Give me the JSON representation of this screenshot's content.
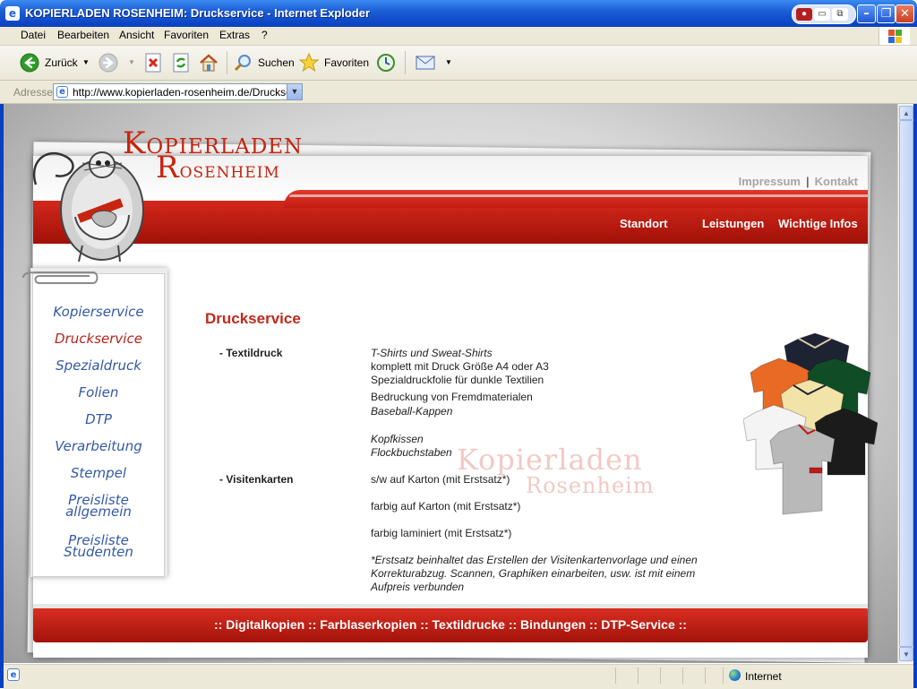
{
  "window": {
    "title": "KOPIERLADEN ROSENHEIM: Druckservice - Internet Exploder"
  },
  "menu": [
    "Datei",
    "Bearbeiten",
    "Ansicht",
    "Favoriten",
    "Extras",
    "?"
  ],
  "toolbar": {
    "back": "Zurück",
    "search": "Suchen",
    "favorites": "Favoriten"
  },
  "address": {
    "label": "Adresse",
    "url": "http://www.kopierladen-rosenheim.de/Druckservice"
  },
  "site": {
    "logo_line1": "Kopierladen",
    "logo_line2": "Rosenheim",
    "top_links": [
      "Impressum",
      "Kontakt"
    ],
    "nav": [
      "Standort",
      "Leistungen",
      "Wichtige Infos"
    ],
    "sidebar": [
      {
        "label": "Kopierservice",
        "active": false
      },
      {
        "label": "Druckservice",
        "active": true
      },
      {
        "label": "Spezialdruck",
        "active": false
      },
      {
        "label": "Folien",
        "active": false
      },
      {
        "label": "DTP",
        "active": false
      },
      {
        "label": "Verarbeitung",
        "active": false
      },
      {
        "label": "Stempel",
        "active": false
      },
      {
        "label": "Preisliste",
        "label2": "allgemein",
        "active": false
      },
      {
        "label": "Preisliste",
        "label2": "Studenten",
        "active": false
      }
    ],
    "page_title": "Druckservice",
    "sections": [
      {
        "label": "- Textildruck",
        "lines": [
          {
            "text": "T-Shirts und Sweat-Shirts",
            "italic": true
          },
          {
            "text": "komplett mit Druck Größe A4 oder A3",
            "italic": false
          },
          {
            "text": "Spezialdruckfolie für dunkle Textilien",
            "italic": false
          },
          {
            "text": "Bedruckung von Fremdmaterialen",
            "italic": false
          },
          {
            "text": "Baseball-Kappen",
            "italic": true
          },
          {
            "text": "Kopfkissen",
            "italic": true
          },
          {
            "text": "Flockbuchstaben",
            "italic": true
          }
        ]
      },
      {
        "label": "- Visitenkarten",
        "lines": [
          {
            "text": "s/w auf Karton (mit Erstsatz*)",
            "italic": false
          },
          {
            "text": "farbig auf Karton (mit Erstsatz*)",
            "italic": false
          },
          {
            "text": "farbig laminiert (mit Erstsatz*)",
            "italic": false
          },
          {
            "text": "*Erstsatz beinhaltet das Erstellen der Visitenkartenvorlage und einen",
            "italic": true
          },
          {
            "text": "Korrekturabzug. Scannen, Graphiken einarbeiten, usw. ist mit einem",
            "italic": true
          },
          {
            "text": "Aufpreis verbunden",
            "italic": true
          }
        ]
      }
    ],
    "watermark_line1": "Kopierladen",
    "watermark_line2": "Rosenheim",
    "footer": ":: Digitalkopien :: Farblaserkopien :: Textildrucke :: Bindungen :: DTP-Service ::"
  },
  "status": {
    "zone": "Internet"
  }
}
